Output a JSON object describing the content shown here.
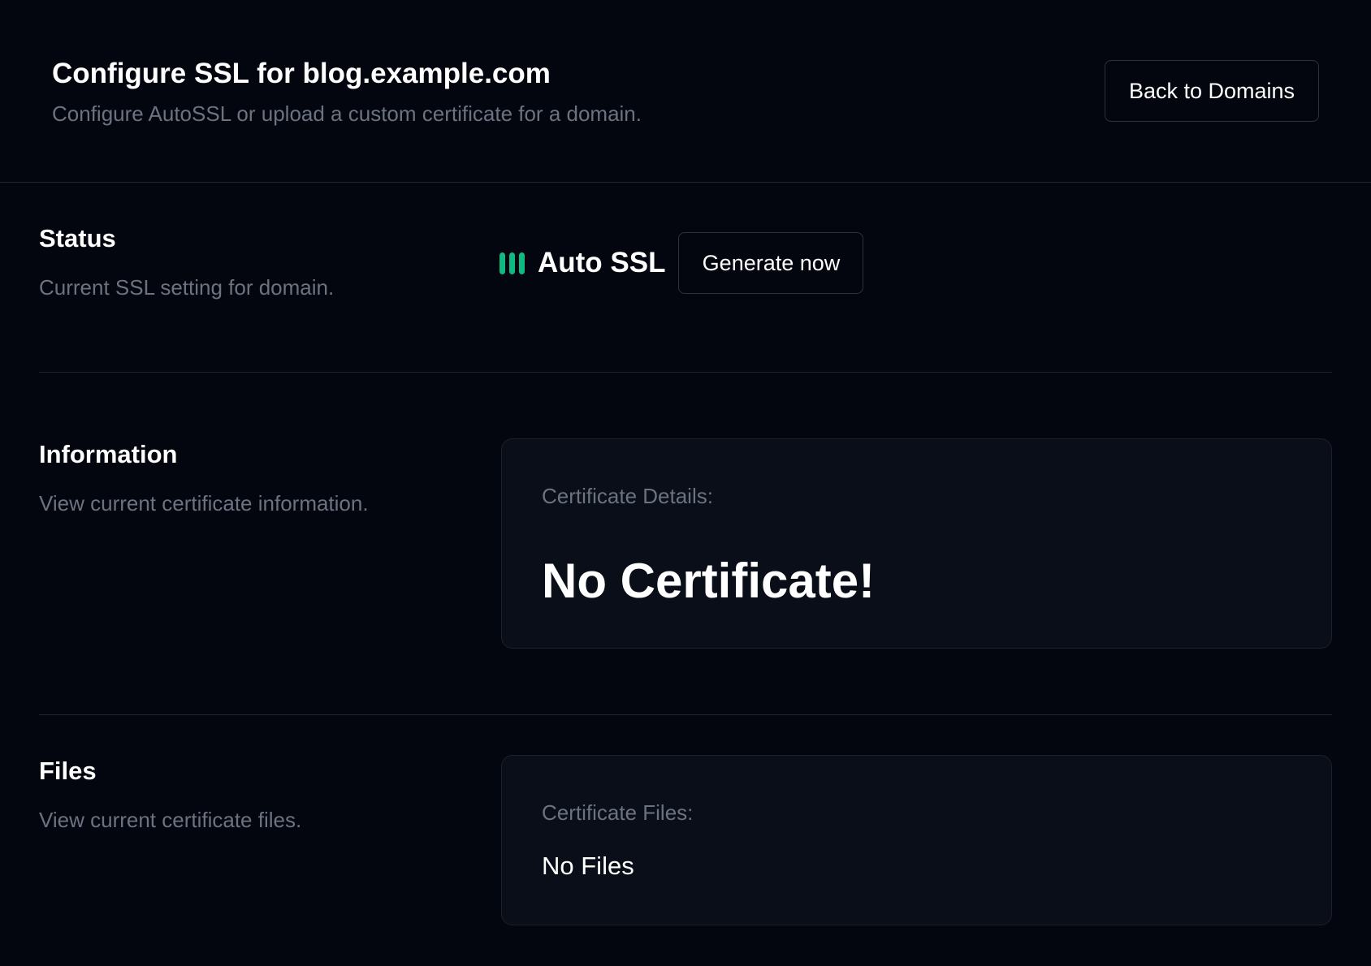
{
  "header": {
    "title": "Configure SSL for blog.example.com",
    "subtitle": "Configure AutoSSL or upload a custom certificate for a domain.",
    "back_button_label": "Back to Domains"
  },
  "status": {
    "title": "Status",
    "description": "Current SSL setting for domain.",
    "current_setting": "Auto SSL",
    "generate_button_label": "Generate now",
    "indicator_icon": "bars-icon",
    "indicator_color": "#10b981"
  },
  "information": {
    "title": "Information",
    "description": "View current certificate information.",
    "card_label": "Certificate Details:",
    "card_value": "No Certificate!"
  },
  "files": {
    "title": "Files",
    "description": "View current certificate files.",
    "card_label": "Certificate Files:",
    "card_value": "No Files"
  },
  "colors": {
    "background": "#03060f",
    "card_background": "#0a0e18",
    "muted_text": "#6b7280",
    "accent": "#10b981"
  }
}
